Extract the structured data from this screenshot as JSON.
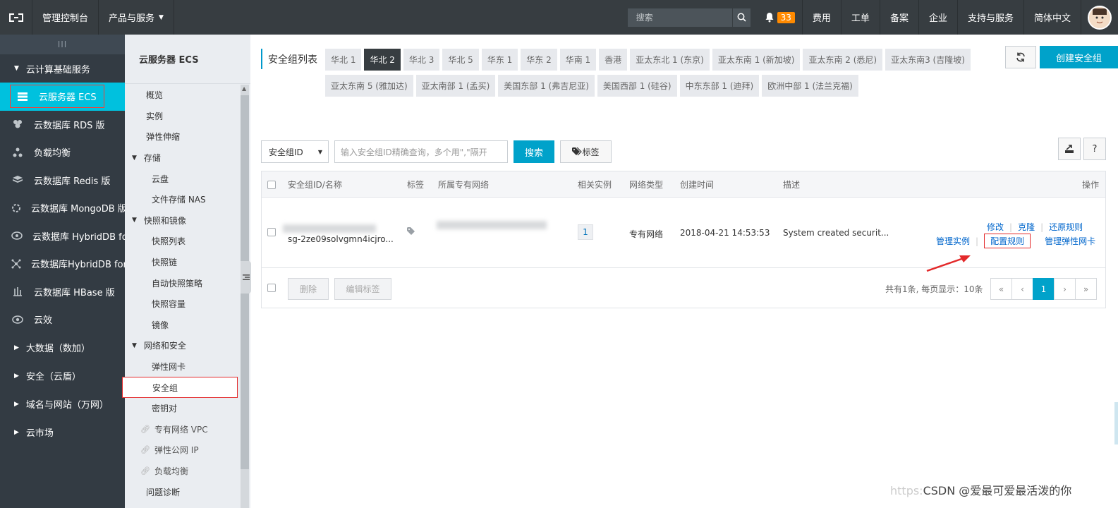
{
  "topbar": {
    "console": "管理控制台",
    "products": "产品与服务",
    "search_placeholder": "搜索",
    "notification_count": "33",
    "links": [
      "费用",
      "工单",
      "备案",
      "企业",
      "支持与服务",
      "简体中文"
    ]
  },
  "sidebar": {
    "handle": "III",
    "group_open": "云计算基础服务",
    "items": [
      {
        "label": "云服务器 ECS",
        "icon": "server-icon"
      },
      {
        "label": "云数据库 RDS 版",
        "icon": "database-icon"
      },
      {
        "label": "负载均衡",
        "icon": "loadbalance-icon"
      },
      {
        "label": "云数据库 Redis 版",
        "icon": "redis-icon"
      },
      {
        "label": "云数据库 MongoDB 版",
        "icon": "mongodb-icon"
      },
      {
        "label": "云数据库 HybridDB fo...",
        "icon": "hybriddb-icon"
      },
      {
        "label": "云数据库HybridDB for...",
        "icon": "hybriddb2-icon"
      },
      {
        "label": "云数据库 HBase 版",
        "icon": "hbase-icon"
      },
      {
        "label": "云效",
        "icon": "eye-icon"
      }
    ],
    "groups_closed": [
      "大数据（数加）",
      "安全（云盾）",
      "域名与网站（万网）",
      "云市场"
    ]
  },
  "subnav": {
    "title": "云服务器 ECS",
    "overview": "概览",
    "instances": "实例",
    "autoscaling": "弹性伸缩",
    "storage": "存储",
    "disk": "云盘",
    "nas": "文件存储 NAS",
    "snapshots": "快照和镜像",
    "snapshot_list": "快照列表",
    "snapshot_chain": "快照链",
    "auto_snapshot": "自动快照策略",
    "snapshot_capacity": "快照容量",
    "images": "镜像",
    "network": "网络和安全",
    "eni": "弹性网卡",
    "security_group": "安全组",
    "keypair": "密钥对",
    "vpc": "专有网络 VPC",
    "eip": "弹性公网 IP",
    "slb": "负载均衡",
    "diagnose": "问题诊断"
  },
  "main": {
    "region_title": "安全组列表",
    "regions": [
      "华北 1",
      "华北 2",
      "华北 3",
      "华北 5",
      "华东 1",
      "华东 2",
      "华南 1",
      "香港",
      "亚太东北 1 (东京)",
      "亚太东南 1 (新加坡)",
      "亚太东南 2 (悉尼)",
      "亚太东南3 (吉隆坡)",
      "亚太东南 5 (雅加达)",
      "亚太南部 1 (孟买)",
      "美国东部 1 (弗吉尼亚)",
      "美国西部 1 (硅谷)",
      "中东东部 1 (迪拜)",
      "欧洲中部 1 (法兰克福)"
    ],
    "active_region": "华北 2",
    "create_button": "创建安全组",
    "filter_select": "安全组ID",
    "filter_placeholder": "输入安全组ID精确查询，多个用\",\"隔开",
    "search_button": "搜索",
    "tag_button": "标签",
    "help": "?",
    "columns": [
      "安全组ID/名称",
      "标签",
      "所属专有网络",
      "相关实例",
      "网络类型",
      "创建时间",
      "描述",
      "操作"
    ],
    "row": {
      "id": "sg-2ze09solvgmn4icjro...",
      "instances": "1",
      "network_type": "专有网络",
      "created": "2018-04-21 14:53:53",
      "description": "System created securit...",
      "actions_top": [
        "修改",
        "克隆",
        "还原规则"
      ],
      "actions_bottom": [
        "管理实例",
        "配置规则",
        "管理弹性网卡"
      ]
    },
    "delete_button": "删除",
    "edit_tags_button": "编辑标签",
    "pager_info": "共有1条, 每页显示：10条",
    "pager": [
      "«",
      "‹",
      "1",
      "›",
      "»"
    ],
    "watermark_faint": "https:",
    "watermark": "CSDN @爱最可爱最活泼的你"
  },
  "colors": {
    "topbar": "#373d41",
    "sidebar": "#333b43",
    "accent": "#00c1de",
    "primary_button": "#00a2ca",
    "link": "#0066cc",
    "highlight_box": "#e3292a"
  }
}
